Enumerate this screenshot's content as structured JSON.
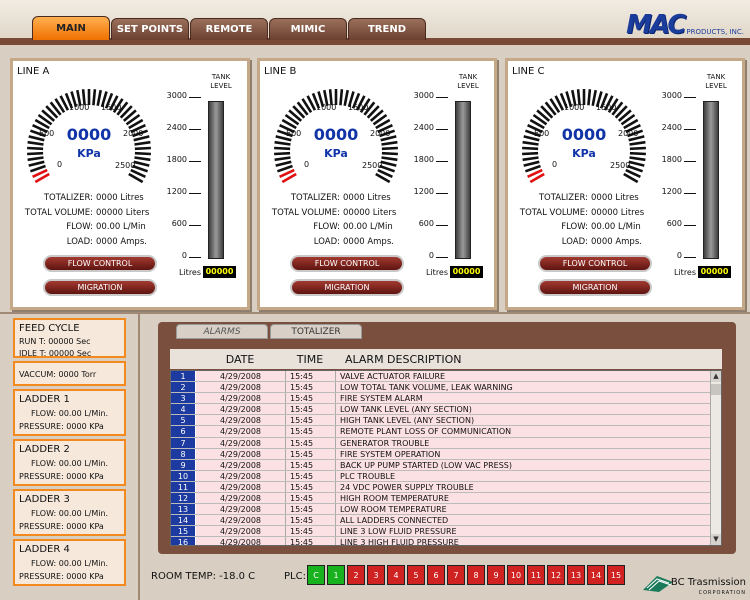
{
  "nav": {
    "tabs": [
      "MAIN",
      "SET POINTS",
      "REMOTE",
      "MIMIC",
      "TREND"
    ],
    "active": 0
  },
  "logo": {
    "mark": "MAC",
    "sub": "PRODUCTS, INC."
  },
  "lines": [
    {
      "name": "LINE A",
      "gauge_value": "0000",
      "unit": "KPa",
      "gauge_level": 0,
      "scale": [
        "0",
        "500",
        "1000",
        "1500",
        "2000",
        "2500"
      ],
      "tank_label": "TANK LEVEL",
      "tank_ticks": [
        "3000",
        "2400",
        "1800",
        "1200",
        "600",
        "0"
      ],
      "tank_level": 0,
      "litres_label": "Litres",
      "litres_value": "00000",
      "stats": [
        [
          "TOTALIZER:",
          "0000 Litres"
        ],
        [
          "TOTAL VOLUME:",
          "00000 Liters"
        ],
        [
          "FLOW:",
          "00.00 L/Min"
        ],
        [
          "LOAD:",
          "0000 Amps."
        ]
      ],
      "flow_btn": "FLOW CONTROL",
      "mig_btn": "MIGRATION"
    },
    {
      "name": "LINE B",
      "gauge_value": "0000",
      "unit": "KPa",
      "gauge_level": 0,
      "scale": [
        "0",
        "500",
        "1000",
        "1500",
        "2000",
        "2500"
      ],
      "tank_label": "TANK LEVEL",
      "tank_ticks": [
        "3000",
        "2400",
        "1800",
        "1200",
        "600",
        "0"
      ],
      "tank_level": 0,
      "litres_label": "Litres",
      "litres_value": "00000",
      "stats": [
        [
          "TOTALIZER:",
          "0000 Litres"
        ],
        [
          "TOTAL VOLUME:",
          "00000 Liters"
        ],
        [
          "FLOW:",
          "00.00 L/Min"
        ],
        [
          "LOAD:",
          "0000 Amps."
        ]
      ],
      "flow_btn": "FLOW CONTROL",
      "mig_btn": "MIGRATION"
    },
    {
      "name": "LINE C",
      "gauge_value": "0000",
      "unit": "KPa",
      "gauge_level": 0,
      "scale": [
        "0",
        "500",
        "1000",
        "1500",
        "2000",
        "2500"
      ],
      "tank_label": "TANK LEVEL",
      "tank_ticks": [
        "3000",
        "2400",
        "1800",
        "1200",
        "600",
        "0"
      ],
      "tank_level": 0,
      "litres_label": "Litres",
      "litres_value": "00000",
      "stats": [
        [
          "TOTALIZER:",
          "0000 Litres"
        ],
        [
          "TOTAL VOLUME:",
          "00000 Litres"
        ],
        [
          "FLOW:",
          "00.00 L/Min"
        ],
        [
          "LOAD:",
          "0000 Amps."
        ]
      ],
      "flow_btn": "FLOW CONTROL",
      "mig_btn": "MIGRATION"
    }
  ],
  "feed_cycle": {
    "title": "FEED CYCLE",
    "run": "RUN T: 00000  Sec",
    "idle": "IDLE T: 00000  Sec"
  },
  "vaccum": "VACCUM: 0000  Torr",
  "ladders": [
    {
      "title": "LADDER 1",
      "flow": "FLOW: 00.00 L/Min.",
      "pressure": "PRESSURE: 0000  KPa"
    },
    {
      "title": "LADDER 2",
      "flow": "FLOW: 00.00 L/Min.",
      "pressure": "PRESSURE: 0000  KPa"
    },
    {
      "title": "LADDER 3",
      "flow": "FLOW: 00.00 L/Min.",
      "pressure": "PRESSURE: 0000  KPa"
    },
    {
      "title": "LADDER 4",
      "flow": "FLOW: 00.00 L/Min.",
      "pressure": "PRESSURE: 0000  KPa"
    }
  ],
  "alarm_tabs": [
    "ALARMS",
    "TOTALIZER"
  ],
  "alarm_header": {
    "date": "DATE",
    "time": "TIME",
    "desc": "ALARM DESCRIPTION"
  },
  "alarms": [
    [
      "1",
      "4/29/2008",
      "15:45",
      "VALVE ACTUATOR FAILURE"
    ],
    [
      "2",
      "4/29/2008",
      "15:45",
      "LOW TOTAL TANK VOLUME, LEAK WARNING"
    ],
    [
      "3",
      "4/29/2008",
      "15:45",
      "FIRE SYSTEM ALARM"
    ],
    [
      "4",
      "4/29/2008",
      "15:45",
      "LOW TANK LEVEL (ANY SECTION)"
    ],
    [
      "5",
      "4/29/2008",
      "15:45",
      "HIGH TANK LEVEL (ANY SECTION)"
    ],
    [
      "6",
      "4/29/2008",
      "15:45",
      "REMOTE PLANT LOSS OF COMMUNICATION"
    ],
    [
      "7",
      "4/29/2008",
      "15:45",
      "GENERATOR TROUBLE"
    ],
    [
      "8",
      "4/29/2008",
      "15:45",
      "FIRE SYSTEM OPERATION"
    ],
    [
      "9",
      "4/29/2008",
      "15:45",
      "BACK UP PUMP STARTED (LOW VAC PRESS)"
    ],
    [
      "10",
      "4/29/2008",
      "15:45",
      "PLC TROUBLE"
    ],
    [
      "11",
      "4/29/2008",
      "15:45",
      "24 VDC POWER SUPPLY TROUBLE"
    ],
    [
      "12",
      "4/29/2008",
      "15:45",
      "HIGH ROOM TEMPERATURE"
    ],
    [
      "13",
      "4/29/2008",
      "15:45",
      "LOW ROOM TEMPERATURE"
    ],
    [
      "14",
      "4/29/2008",
      "15:45",
      "ALL LADDERS CONNECTED"
    ],
    [
      "15",
      "4/29/2008",
      "15:45",
      "LINE 3 LOW FLUID PRESSURE"
    ],
    [
      "16",
      "4/29/2008",
      "15:45",
      "LINE 3 HIGH FLUID PRESSURE"
    ]
  ],
  "room_temp": "ROOM TEMP:  -18.0 C",
  "plc_label": "PLC:",
  "plc_boxes": [
    "C",
    "1",
    "2",
    "3",
    "4",
    "5",
    "6",
    "7",
    "8",
    "9",
    "10",
    "11",
    "12",
    "13",
    "14",
    "15"
  ],
  "plc_ok": [
    true,
    true,
    false,
    false,
    false,
    false,
    false,
    false,
    false,
    false,
    false,
    false,
    false,
    false,
    false,
    false
  ],
  "company": {
    "name": "BC Trasmission",
    "sub": "CORPORATION"
  },
  "colors": {
    "accent": "#f07000",
    "brown": "#7a4a36",
    "gauge_blue": "#1033a8",
    "alarm_row": "#fbe0e4",
    "plc_ok": "#19b21f",
    "plc_fault": "#d12222"
  }
}
